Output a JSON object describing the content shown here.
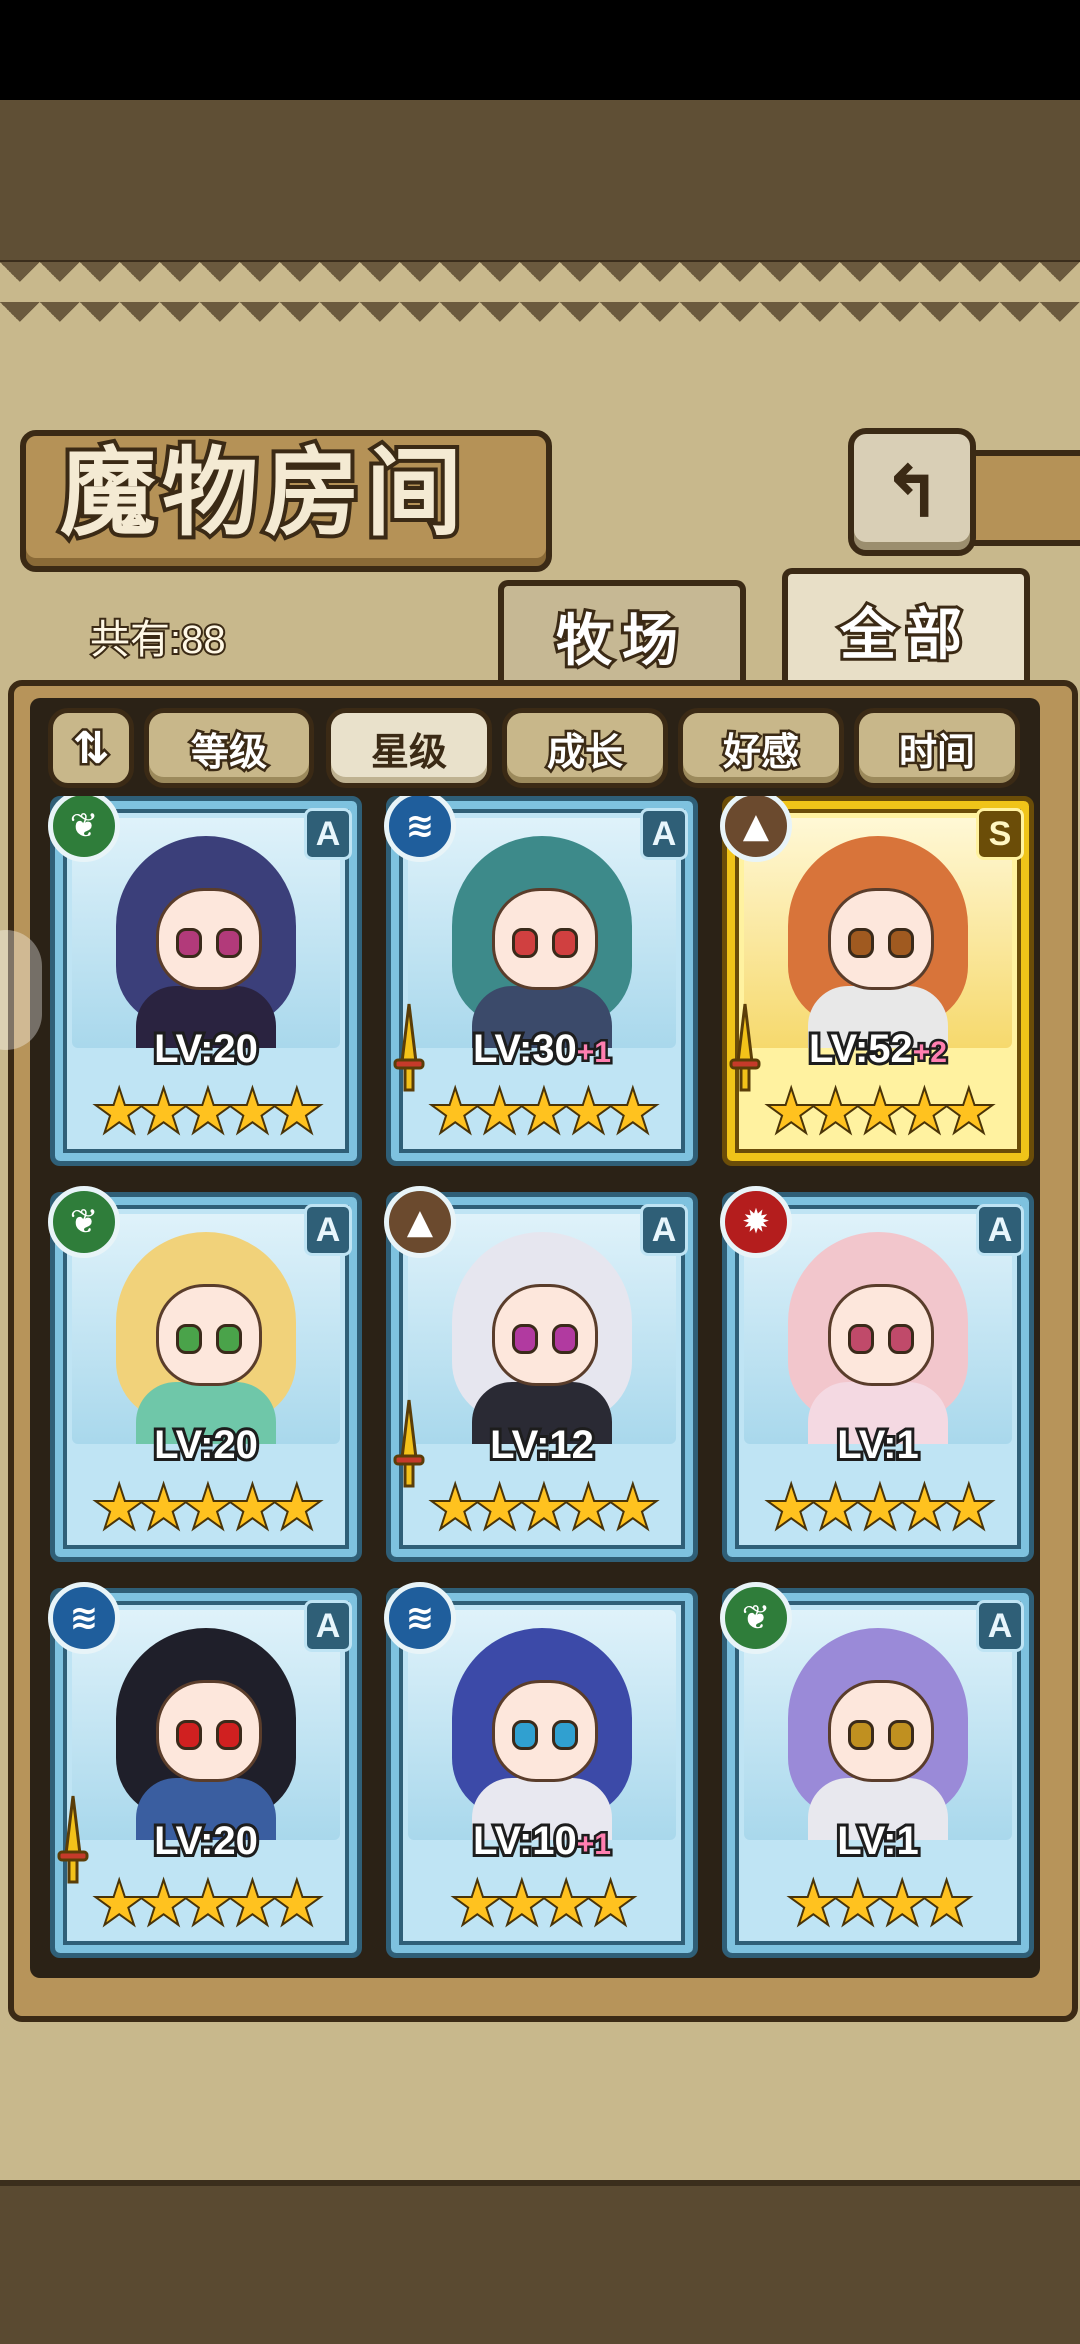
{
  "screen": {
    "title": "魔物房间",
    "back_icon": "return-icon",
    "count_text": "共有:88"
  },
  "tabs": [
    {
      "label": "牧场",
      "active": false
    },
    {
      "label": "全部",
      "active": true
    }
  ],
  "filters": {
    "toggle_icon": "sort-toggle-icon",
    "toggle_glyph": "⇅",
    "buttons": [
      {
        "label": "等级",
        "selected": false
      },
      {
        "label": "星级",
        "selected": true
      },
      {
        "label": "成长",
        "selected": false
      },
      {
        "label": "好感",
        "selected": false
      },
      {
        "label": "时间",
        "selected": false
      }
    ]
  },
  "element_colors": {
    "leaf": "#2f7d3a",
    "water": "#1f5e9c",
    "earth": "#6b4a2e",
    "fire": "#b41d1d"
  },
  "monsters": [
    {
      "element": "leaf",
      "element_glyph": "❦",
      "rank": "A",
      "level": "LV:20",
      "plus": "",
      "stars": "★★★★★",
      "stars_count": 5,
      "equipped": false,
      "gold": false,
      "hair": "#3b3f7a",
      "body": "#2a2340",
      "eye": "#b23a7a"
    },
    {
      "element": "water",
      "element_glyph": "≋",
      "rank": "A",
      "level": "LV:30",
      "plus": "+1",
      "stars": "★★★★★",
      "stars_count": 5,
      "equipped": true,
      "gold": false,
      "hair": "#3d8a8a",
      "body": "#3b4a6a",
      "eye": "#d04040"
    },
    {
      "element": "earth",
      "element_glyph": "▲",
      "rank": "S",
      "level": "LV:52",
      "plus": "+2",
      "stars": "★★★★★",
      "stars_count": 5,
      "equipped": true,
      "gold": true,
      "hair": "#d8743a",
      "body": "#e8e8e8",
      "eye": "#a05a20"
    },
    {
      "element": "leaf",
      "element_glyph": "❦",
      "rank": "A",
      "level": "LV:20",
      "plus": "",
      "stars": "★★★★★",
      "stars_count": 5,
      "equipped": false,
      "gold": false,
      "hair": "#f1d27a",
      "body": "#6fc7a9",
      "eye": "#4aa34a"
    },
    {
      "element": "earth",
      "element_glyph": "▲",
      "rank": "A",
      "level": "LV:12",
      "plus": "",
      "stars": "★★★★★",
      "stars_count": 5,
      "equipped": true,
      "gold": false,
      "hair": "#e6e6ef",
      "body": "#2a2a34",
      "eye": "#b13aa0"
    },
    {
      "element": "fire",
      "element_glyph": "✹",
      "rank": "A",
      "level": "LV:1",
      "plus": "",
      "stars": "★★★★★",
      "stars_count": 5,
      "equipped": false,
      "gold": false,
      "hair": "#f2c6cc",
      "body": "#f4d9e2",
      "eye": "#c04a6a"
    },
    {
      "element": "water",
      "element_glyph": "≋",
      "rank": "A",
      "level": "LV:20",
      "plus": "",
      "stars": "★★★★★",
      "stars_count": 5,
      "equipped": true,
      "gold": false,
      "hair": "#1f1f2a",
      "body": "#3a5ea0",
      "eye": "#d02020"
    },
    {
      "element": "water",
      "element_glyph": "≋",
      "rank": "",
      "level": "LV:10",
      "plus": "+1",
      "stars": "★★★★",
      "stars_count": 4,
      "equipped": false,
      "gold": false,
      "hair": "#3c4aa8",
      "body": "#e8e8f0",
      "eye": "#30a0d0"
    },
    {
      "element": "leaf",
      "element_glyph": "❦",
      "rank": "A",
      "level": "LV:1",
      "plus": "",
      "stars": "★★★★",
      "stars_count": 4,
      "equipped": false,
      "gold": false,
      "hair": "#9a8ad8",
      "body": "#e8e8ee",
      "eye": "#c09020"
    }
  ]
}
